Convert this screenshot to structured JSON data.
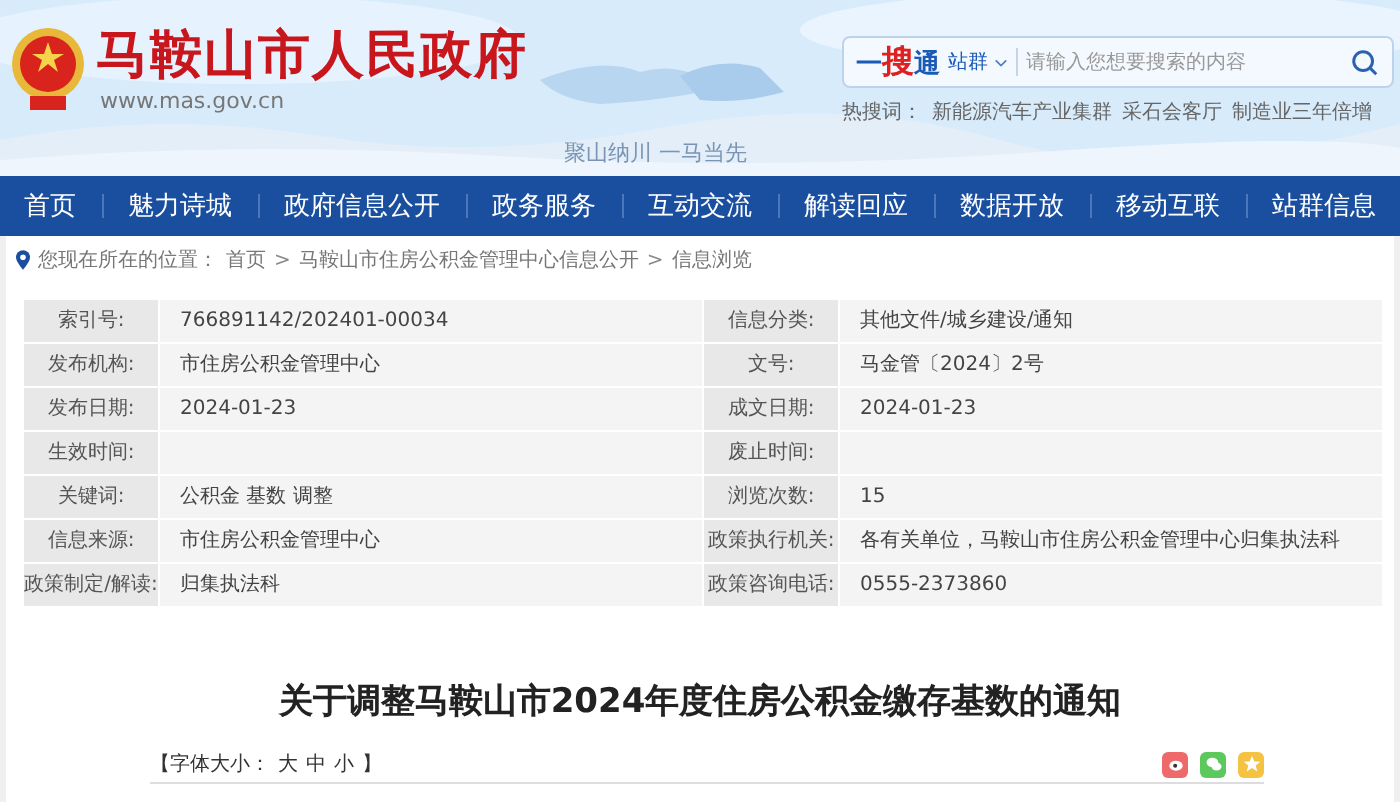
{
  "header": {
    "site_title": "马鞍山市人民政府",
    "site_url": "www.mas.gov.cn",
    "slogan": "聚山纳川 一马当先",
    "search": {
      "logo": [
        {
          "text": "一",
          "color": "#1a5bb5"
        },
        {
          "text": "搜",
          "color": "#e02020"
        },
        {
          "text": "通",
          "color": "#1a5bb5"
        }
      ],
      "scope": "站群",
      "placeholder": "请输入您想要搜索的内容"
    },
    "hot_label": "热搜词：",
    "hot_words": [
      "新能源汽车产业集群",
      "采石会客厅",
      "制造业三年倍增"
    ]
  },
  "nav": [
    "首页",
    "魅力诗城",
    "政府信息公开",
    "政务服务",
    "互动交流",
    "解读回应",
    "数据开放",
    "移动互联",
    "站群信息"
  ],
  "breadcrumb": {
    "label": "您现在所在的位置：",
    "separator": ">",
    "items": [
      "首页",
      "马鞍山市住房公积金管理中心信息公开",
      "信息浏览"
    ]
  },
  "info_table": [
    [
      {
        "label": "索引号:",
        "value": "766891142/202401-00034"
      },
      {
        "label": "信息分类:",
        "value": "其他文件/城乡建设/通知"
      }
    ],
    [
      {
        "label": "发布机构:",
        "value": "市住房公积金管理中心"
      },
      {
        "label": "文号:",
        "value": "马金管〔2024〕2号"
      }
    ],
    [
      {
        "label": "发布日期:",
        "value": "2024-01-23"
      },
      {
        "label": "成文日期:",
        "value": "2024-01-23"
      }
    ],
    [
      {
        "label": "生效时间:"
      },
      {
        "label": "废止时间:"
      }
    ],
    [
      {
        "label": "关键词:",
        "value": "公积金 基数 调整"
      },
      {
        "label": "浏览次数:",
        "value": "15"
      }
    ],
    [
      {
        "label": "信息来源:",
        "value": "市住房公积金管理中心"
      },
      {
        "label": "政策执行机关:",
        "value": "各有关单位，马鞍山市住房公积金管理中心归集执法科"
      }
    ],
    [
      {
        "label": "政策制定/解读:",
        "value": "归集执法科"
      },
      {
        "label": "政策咨询电话:",
        "value": "0555-2373860"
      }
    ]
  ],
  "article": {
    "title": "关于调整马鞍山市2024年度住房公积金缴存基数的通知",
    "font_label": "【字体大小：",
    "font_sizes": [
      "大",
      "中",
      "小"
    ],
    "font_end": "】",
    "share": [
      {
        "kind": "weibo",
        "color": "#ee6a6a"
      },
      {
        "kind": "wechat",
        "color": "#5cc95c"
      },
      {
        "kind": "favorite",
        "color": "#f5c242"
      }
    ]
  }
}
